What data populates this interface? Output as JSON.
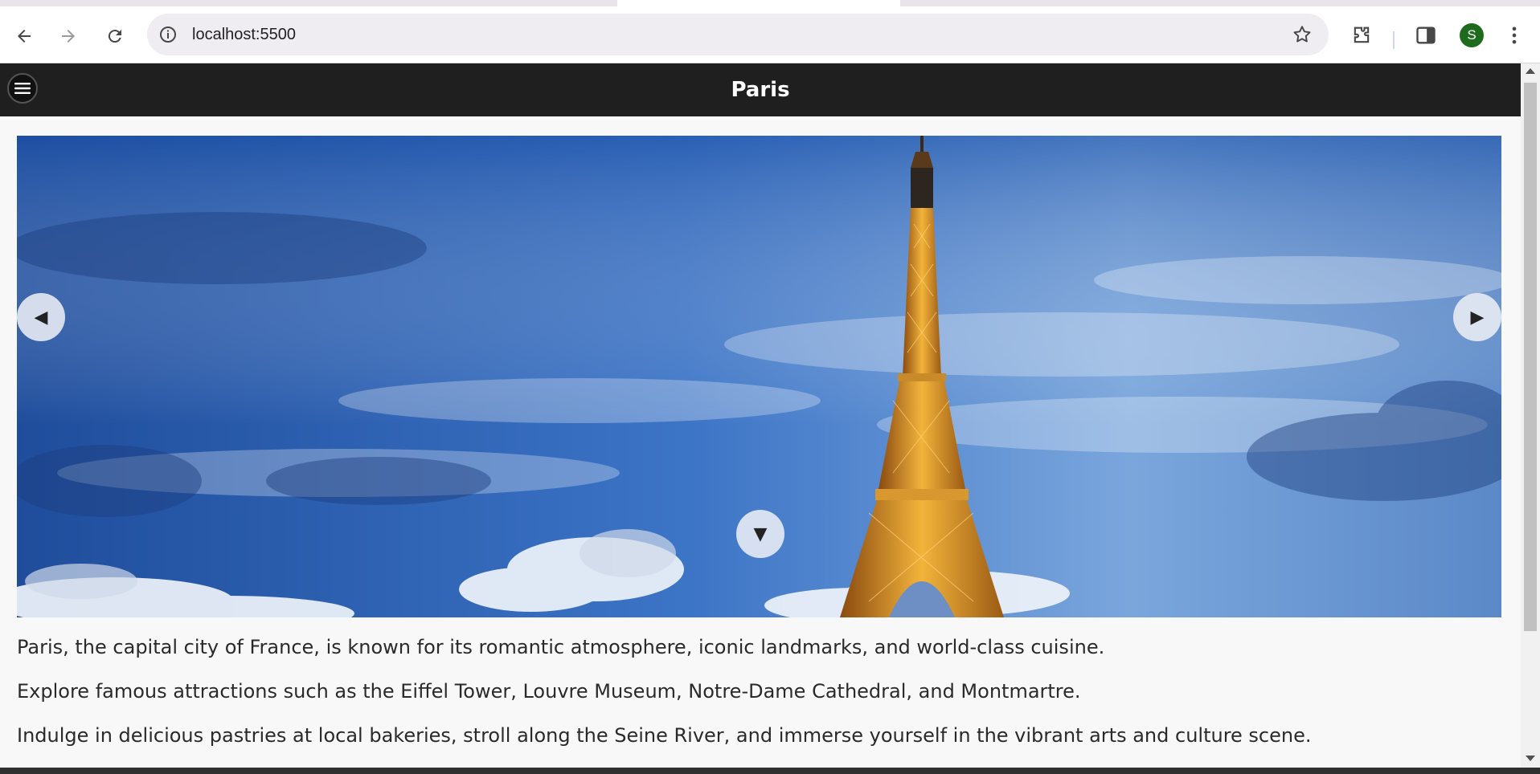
{
  "browser": {
    "url": "localhost:5500",
    "profile_initial": "S",
    "icons": {
      "back": "arrow-left-icon",
      "forward": "arrow-right-icon",
      "reload": "reload-icon",
      "site_info": "info-icon",
      "bookmark": "star-icon",
      "extensions": "puzzle-icon",
      "side_panel": "side-panel-icon",
      "menu": "kebab-menu-icon"
    }
  },
  "site": {
    "title": "Paris",
    "menu_icon": "hamburger-icon"
  },
  "carousel": {
    "prev_glyph": "◀",
    "next_glyph": "▶",
    "scroll_glyph": "▼",
    "image_subject": "Eiffel Tower against a blue cloudy sky"
  },
  "content": {
    "paragraphs": [
      "Paris, the capital city of France, is known for its romantic atmosphere, iconic landmarks, and world-class cuisine.",
      "Explore famous attractions such as the Eiffel Tower, Louvre Museum, Notre-Dame Cathedral, and Montmartre.",
      "Indulge in delicious pastries at local bakeries, stroll along the Seine River, and immerse yourself in the vibrant arts and culture scene."
    ]
  },
  "colors": {
    "header_bg": "#1f1f1f",
    "page_bg": "#f8f8f8",
    "avatar_bg": "#1e6b1e",
    "text": "#2a2a2a"
  }
}
